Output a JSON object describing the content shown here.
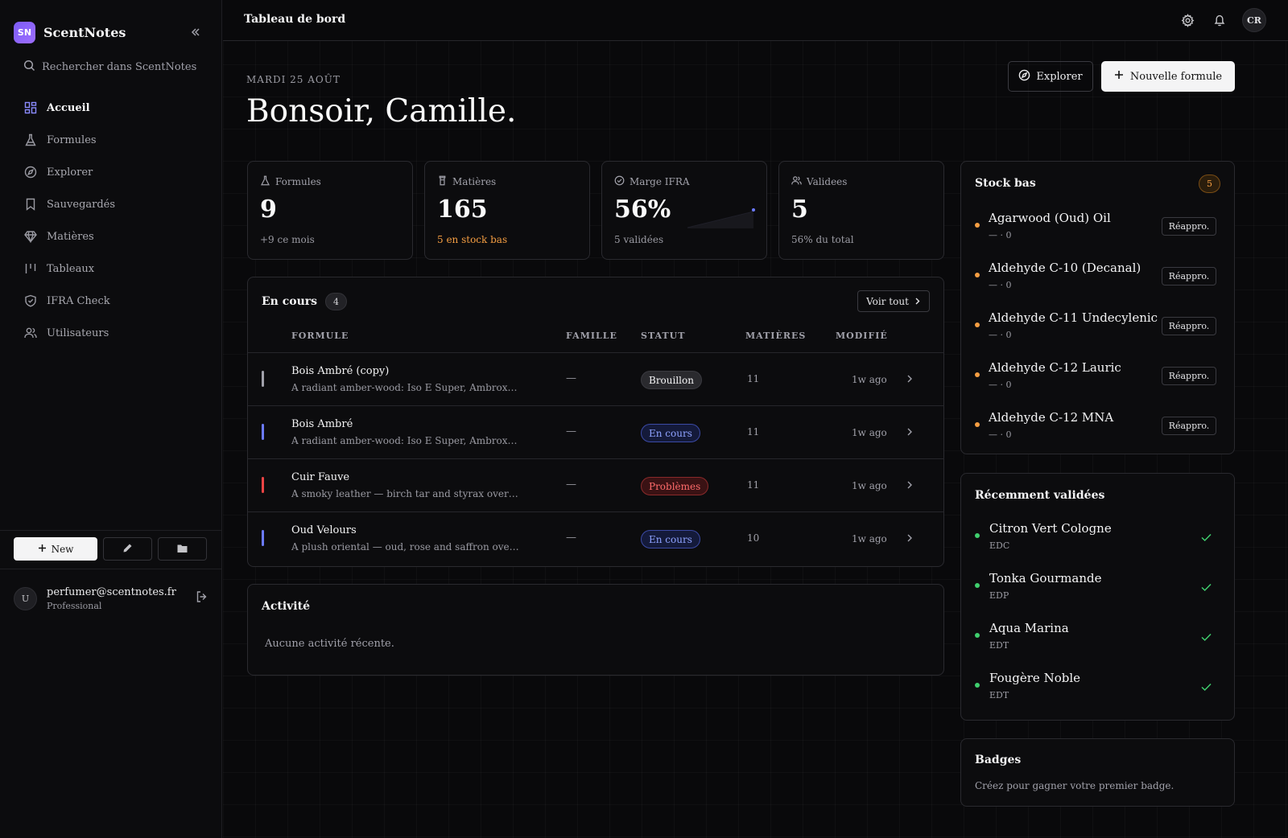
{
  "app": {
    "logo_initials": "SN",
    "name": "ScentNotes"
  },
  "sidebar": {
    "search_placeholder": "Rechercher dans ScentNotes",
    "items": [
      {
        "label": "Accueil",
        "icon": "grid-icon",
        "active": true
      },
      {
        "label": "Formules",
        "icon": "flask-icon"
      },
      {
        "label": "Explorer",
        "icon": "compass-icon"
      },
      {
        "label": "Sauvegardés",
        "icon": "bookmark-icon"
      },
      {
        "label": "Matières",
        "icon": "diamond-icon"
      },
      {
        "label": "Tableaux",
        "icon": "columns-icon"
      },
      {
        "label": "IFRA Check",
        "icon": "shield-check-icon"
      },
      {
        "label": "Utilisateurs",
        "icon": "users-icon"
      }
    ],
    "new_label": "New",
    "user": {
      "initial": "U",
      "email": "perfumer@scentnotes.fr",
      "plan": "Professional"
    }
  },
  "topbar": {
    "title": "Tableau de bord",
    "avatar_initials": "CR"
  },
  "header": {
    "date": "MARDI 25 AOÛT",
    "greeting": "Bonsoir, Camille.",
    "explore_label": "Explorer",
    "new_formula_label": "Nouvelle formule"
  },
  "stats": [
    {
      "label": "Formules",
      "icon": "flask-icon",
      "value": "9",
      "sub": "+9 ce mois"
    },
    {
      "label": "Matières",
      "icon": "bottle-icon",
      "value": "165",
      "sub": "5 en stock bas",
      "warn": true
    },
    {
      "label": "Marge IFRA",
      "icon": "check-circle-icon",
      "value": "56%",
      "sub": "5 validées"
    },
    {
      "label": "Validees",
      "icon": "users-icon",
      "value": "5",
      "sub": "56% du total"
    }
  ],
  "in_progress": {
    "title": "En cours",
    "count": "4",
    "view_all": "Voir tout",
    "columns": [
      "FORMULE",
      "FAMILLE",
      "STATUT",
      "MATIÈRES",
      "MODIFIÉ"
    ],
    "rows": [
      {
        "name": "Bois Ambré (copy)",
        "desc": "A radiant amber-wood: Iso E Super, Ambroxan and …",
        "family": "—",
        "status": "Brouillon",
        "status_kind": "draft",
        "materials": "11",
        "modified": "1w ago",
        "bar_color": "#a1a1aa"
      },
      {
        "name": "Bois Ambré",
        "desc": "A radiant amber-wood: Iso E Super, Ambroxan and …",
        "family": "—",
        "status": "En cours",
        "status_kind": "progress",
        "materials": "11",
        "modified": "1w ago",
        "bar_color": "#6c7bff"
      },
      {
        "name": "Cuir Fauve",
        "desc": "A smoky leather — birch tar and styrax over dry w…",
        "family": "—",
        "status": "Problèmes",
        "status_kind": "problem",
        "materials": "11",
        "modified": "1w ago",
        "bar_color": "#ef4444"
      },
      {
        "name": "Oud Velours",
        "desc": "A plush oriental — oud, rose and saffron over labda…",
        "family": "—",
        "status": "En cours",
        "status_kind": "progress",
        "materials": "10",
        "modified": "1w ago",
        "bar_color": "#6c7bff"
      }
    ]
  },
  "activity": {
    "title": "Activité",
    "empty": "Aucune activité récente."
  },
  "low_stock": {
    "title": "Stock bas",
    "count": "5",
    "action_label": "Réappro.",
    "items": [
      {
        "name": "Agarwood (Oud) Oil",
        "sub": "— · 0"
      },
      {
        "name": "Aldehyde C-10 (Decanal)",
        "sub": "— · 0"
      },
      {
        "name": "Aldehyde C-11 Undecylenic",
        "sub": "— · 0"
      },
      {
        "name": "Aldehyde C-12 Lauric",
        "sub": "— · 0"
      },
      {
        "name": "Aldehyde C-12 MNA",
        "sub": "— · 0"
      }
    ]
  },
  "recently_validated": {
    "title": "Récemment validées",
    "items": [
      {
        "name": "Citron Vert Cologne",
        "type": "EDC"
      },
      {
        "name": "Tonka Gourmande",
        "type": "EDP"
      },
      {
        "name": "Aqua Marina",
        "type": "EDT"
      },
      {
        "name": "Fougère Noble",
        "type": "EDT"
      }
    ]
  },
  "badges": {
    "title": "Badges",
    "empty": "Créez pour gagner votre premier badge."
  },
  "colors": {
    "accent": "#7c5cf5",
    "warn": "#f59e42",
    "ok": "#3fcf6e",
    "danger": "#ef4444",
    "progress": "#6c7bff"
  }
}
